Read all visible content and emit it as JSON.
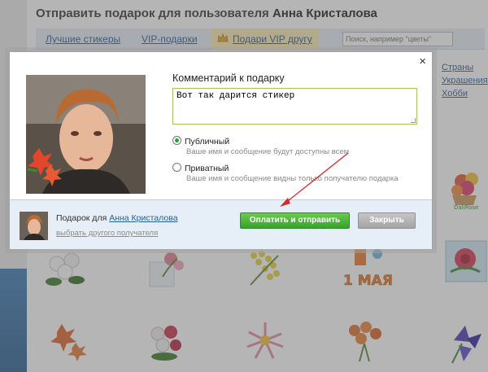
{
  "page": {
    "title_prefix": "Отправить подарок для пользователя",
    "title_user": "Анна Кристалова",
    "tabs": [
      {
        "label": "Лучшие стикеры"
      },
      {
        "label": "VIP-подарки"
      },
      {
        "label": "Подари VIP другу"
      }
    ],
    "search": {
      "placeholder": "Поиск, например \"цветы\""
    },
    "categories": [
      "Страны",
      "Украшения",
      "Хобби"
    ],
    "tile_captions": {
      "badge": "1 МАЯ",
      "flower_sticker": "DaliRose"
    }
  },
  "modal": {
    "close_glyph": "×",
    "comment_label": "Комментарий к подарку",
    "comment_value": "Вот так дарится стикер",
    "public": {
      "label": "Публичный",
      "hint": "Ваше имя и сообщение будут доступны всем",
      "selected": true
    },
    "private": {
      "label": "Приватный",
      "hint": "Ваше имя и сообщение видны только получателю подарка",
      "selected": false
    },
    "footer": {
      "gift_for": "Подарок для",
      "recipient": "Анна Кристалова",
      "change_recipient": "выбрать другого получателя",
      "pay_button": "Оплатить и отправить",
      "close_button": "Закрыть"
    }
  },
  "colors": {
    "accent_green": "#37a32d",
    "link_blue": "#2b5c9a",
    "arrow_red": "#d42a2a",
    "comment_border": "#a3c35a"
  }
}
